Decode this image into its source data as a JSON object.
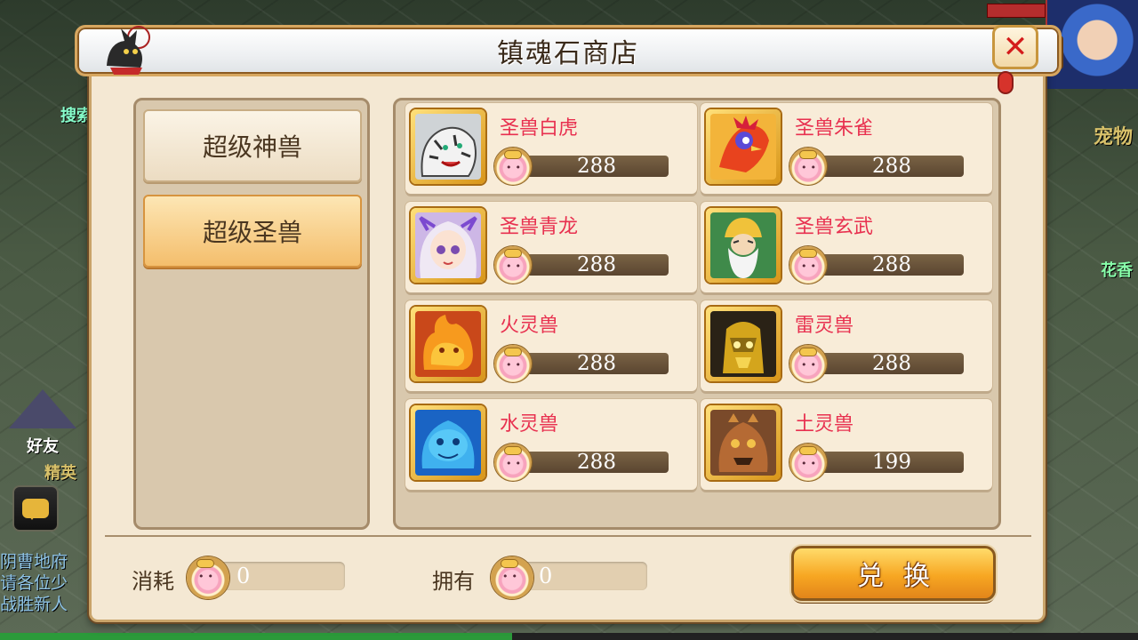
{
  "shop": {
    "title": "镇魂石商店",
    "close_symbol": "✕"
  },
  "categories": [
    {
      "label": "超级神兽",
      "active": false
    },
    {
      "label": "超级圣兽",
      "active": true
    }
  ],
  "items": [
    {
      "name": "圣兽白虎",
      "price": "288",
      "icon": "white-tiger"
    },
    {
      "name": "圣兽朱雀",
      "price": "288",
      "icon": "vermilion-bird"
    },
    {
      "name": "圣兽青龙",
      "price": "288",
      "icon": "azure-dragon"
    },
    {
      "name": "圣兽玄武",
      "price": "288",
      "icon": "black-tortoise"
    },
    {
      "name": "火灵兽",
      "price": "288",
      "icon": "fire-spirit"
    },
    {
      "name": "雷灵兽",
      "price": "288",
      "icon": "thunder-spirit"
    },
    {
      "name": "水灵兽",
      "price": "288",
      "icon": "water-spirit"
    },
    {
      "name": "土灵兽",
      "price": "199",
      "icon": "earth-spirit"
    }
  ],
  "footer": {
    "cost_label": "消耗",
    "cost_value": "0",
    "owned_label": "拥有",
    "owned_value": "0",
    "exchange_label": "兑换"
  },
  "background": {
    "friends_label": "好友",
    "elite_label": "精英",
    "pet_label": "宠物",
    "right_label": "花香",
    "left_label": "搜索",
    "chat_lines": [
      "阴曹地府",
      "请各位少",
      "战胜新人"
    ]
  }
}
